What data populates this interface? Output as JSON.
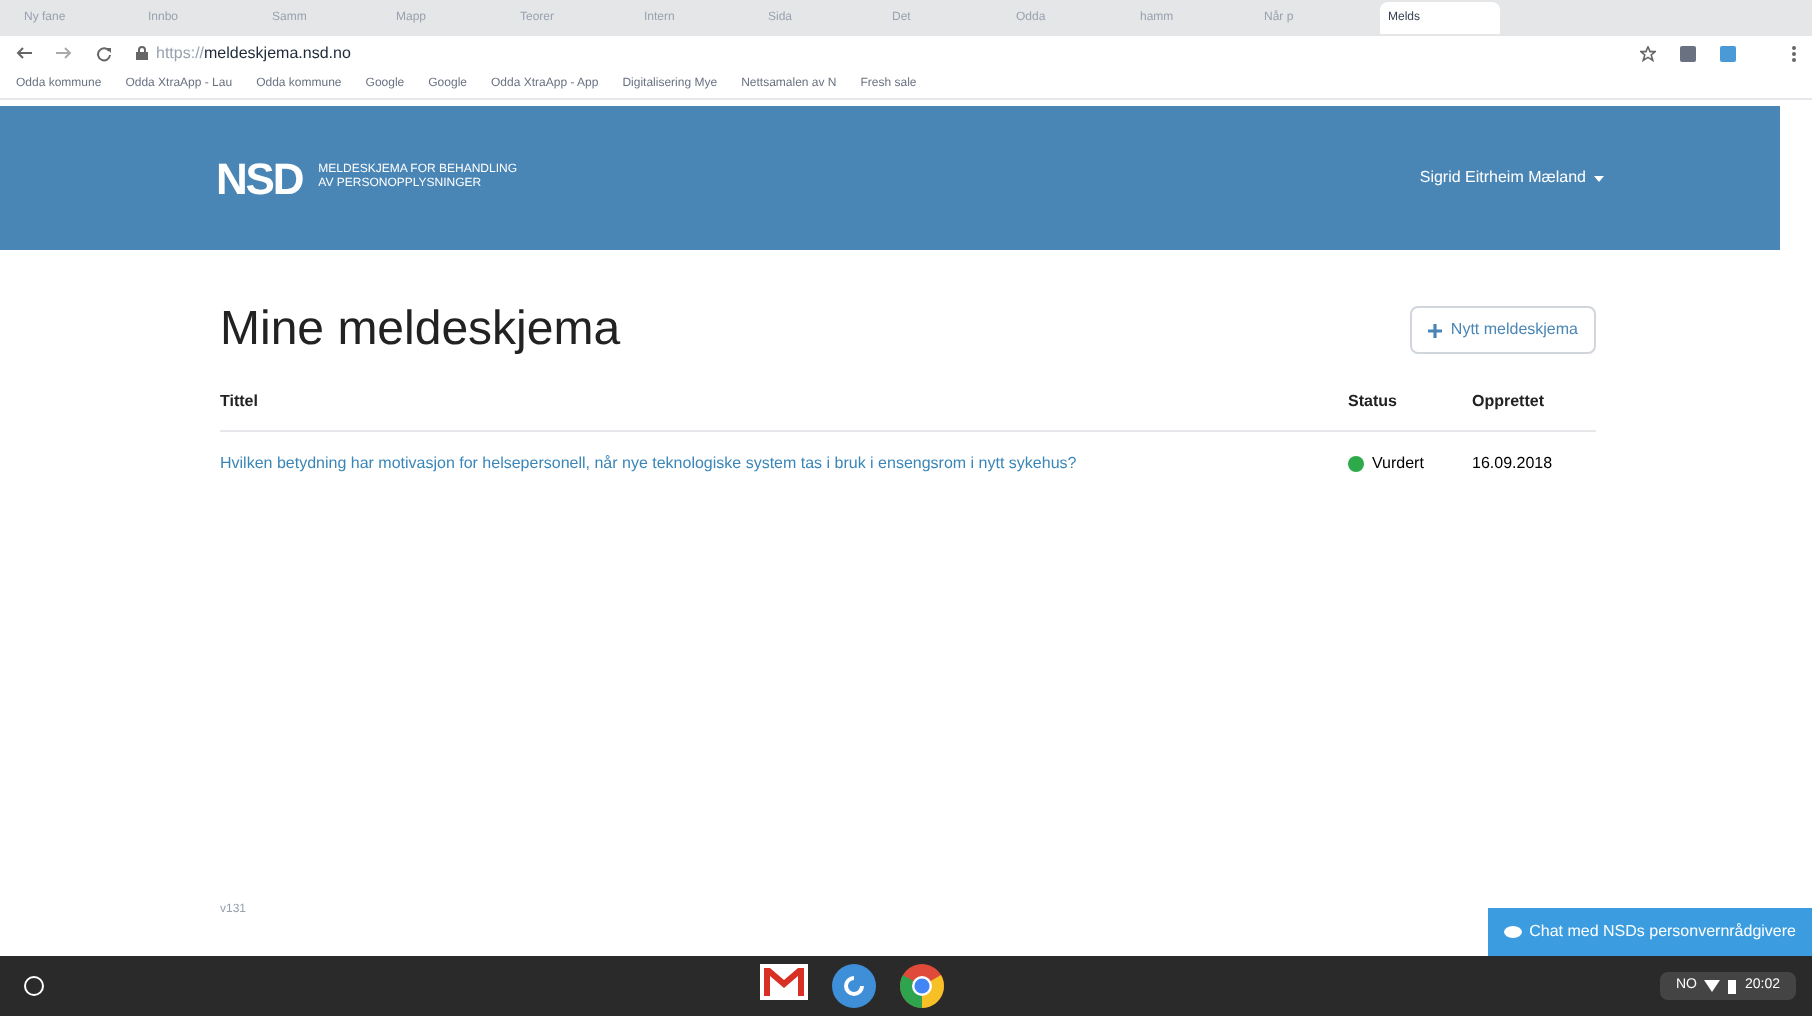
{
  "browser": {
    "tabs": [
      {
        "title": "Ny fane",
        "selected": false
      },
      {
        "title": "Innbo",
        "selected": false
      },
      {
        "title": "Samm",
        "selected": false
      },
      {
        "title": "Mapp",
        "selected": false
      },
      {
        "title": "Teorer",
        "selected": false
      },
      {
        "title": "Intern",
        "selected": false
      },
      {
        "title": "Sida",
        "selected": false
      },
      {
        "title": "Det",
        "selected": false
      },
      {
        "title": "Odda",
        "selected": false
      },
      {
        "title": "hamm",
        "selected": false
      },
      {
        "title": "Når p",
        "selected": false
      },
      {
        "title": "Melds",
        "selected": true
      }
    ],
    "url_prefix": "https://",
    "url_host": "meldeskjema.nsd.no",
    "bookmarks": [
      "Odda kommune",
      "Odda XtraApp - Lau",
      "Odda kommune",
      "Google",
      "Google",
      "Odda XtraApp - App",
      "Digitalisering Mye",
      "Nettsamalen av N",
      "Fresh sale"
    ]
  },
  "header": {
    "logo": "NSD",
    "subtitle_1": "MELDESKJEMA FOR BEHANDLING",
    "subtitle_2": "AV PERSONOPPLYSNINGER",
    "user": "Sigrid Eitrheim Mæland"
  },
  "page": {
    "title": "Mine meldeskjema",
    "new_button": "Nytt meldeskjema",
    "table": {
      "columns": [
        "Tittel",
        "Status",
        "Opprettet"
      ],
      "rows": [
        {
          "title": "Hvilken betydning har motivasjon for helsepersonell, når nye teknologiske system tas i bruk i ensengsrom i nytt sykehus?",
          "status": "Vurdert",
          "color": "#2eaa4a",
          "created": "16.09.2018"
        }
      ]
    }
  },
  "version": "v131",
  "chat_button": "Chat med NSDs personvernrådgivere",
  "taskbar": {
    "lang": "NO",
    "time": "20:02"
  }
}
